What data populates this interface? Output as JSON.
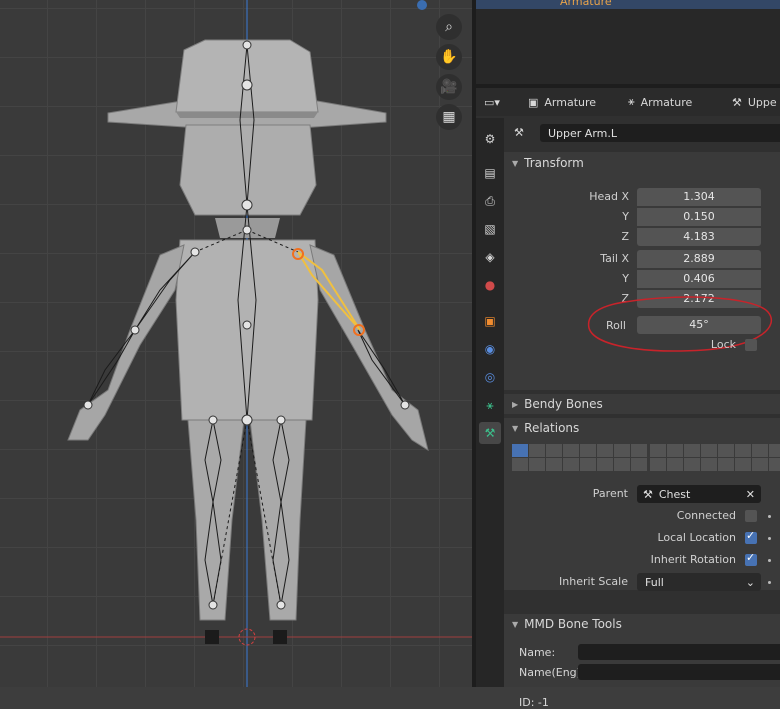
{
  "viewport": {
    "tools": [
      {
        "icon": "zoom-icon",
        "glyph": "⌕"
      },
      {
        "icon": "hand-icon",
        "glyph": "✋"
      },
      {
        "icon": "camera-icon",
        "glyph": "🎥"
      },
      {
        "icon": "grid-icon",
        "glyph": "▦"
      }
    ],
    "accent_selected_bone": "#f0a030",
    "axis_x_color": "#c24c4c",
    "axis_z_color": "#3a7bd5"
  },
  "outliner": {
    "armature_label": "Armature"
  },
  "properties": {
    "header": {
      "object_label": "Armature",
      "data_label": "Armature",
      "bone_label": "Uppe"
    },
    "bone_name": "Upper Arm.L",
    "transform": {
      "title": "Transform",
      "head_x_label": "Head X",
      "head_x": "1.304",
      "head_y_label": "Y",
      "head_y": "0.150",
      "head_z_label": "Z",
      "head_z": "4.183",
      "tail_x_label": "Tail X",
      "tail_x": "2.889",
      "tail_y_label": "Y",
      "tail_y": "0.406",
      "tail_z_label": "Z",
      "tail_z": "2.172",
      "roll_label": "Roll",
      "roll": "45°",
      "lock_label": "Lock",
      "lock_checked": false
    },
    "bendy_bones": {
      "title": "Bendy Bones"
    },
    "relations": {
      "title": "Relations",
      "parent_label": "Parent",
      "parent_value": "Chest",
      "connected_label": "Connected",
      "connected_checked": false,
      "local_location_label": "Local Location",
      "local_location_checked": true,
      "inherit_rotation_label": "Inherit Rotation",
      "inherit_rotation_checked": true,
      "inherit_scale_label": "Inherit Scale",
      "inherit_scale_value": "Full"
    },
    "mmd": {
      "title": "MMD Bone Tools",
      "name_label": "Name:",
      "name_eng_label": "Name(Eng):",
      "id_label": "ID: -1"
    },
    "annotation_color": "#c8232a"
  }
}
